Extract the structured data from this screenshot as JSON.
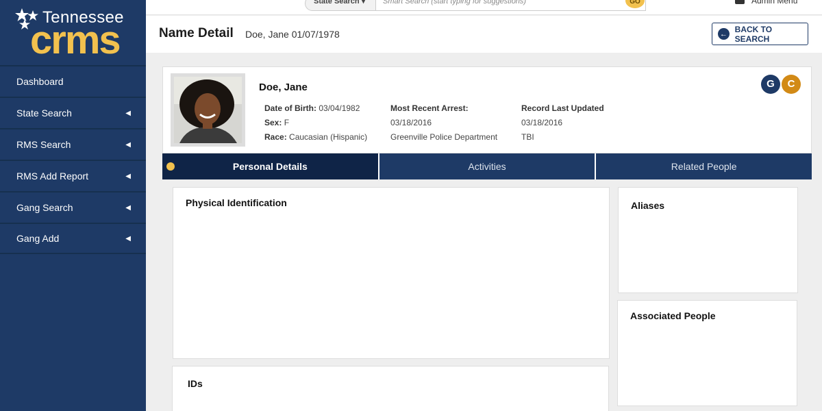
{
  "sidebar": {
    "logo_top": "Tennessee",
    "logo_main": "crms",
    "items": [
      {
        "label": "Dashboard",
        "has_arrow": false
      },
      {
        "label": "State Search",
        "has_arrow": true
      },
      {
        "label": "RMS Search",
        "has_arrow": true
      },
      {
        "label": "RMS Add Report",
        "has_arrow": true
      },
      {
        "label": "Gang Search",
        "has_arrow": true
      },
      {
        "label": "Gang Add",
        "has_arrow": true
      }
    ]
  },
  "topbar": {
    "scope_label": "State Search",
    "search_placeholder": "Smart Search (start typing for suggestions)",
    "go_label": "GO",
    "admin_label": "Admin Menu"
  },
  "header": {
    "title": "Name Detail",
    "subtitle": "Doe, Jane 01/07/1978",
    "back_label": "BACK TO SEARCH"
  },
  "profile": {
    "name": "Doe, Jane",
    "dob_label": "Date of Birth:",
    "dob": "03/04/1982",
    "sex_label": "Sex:",
    "sex": "F",
    "race_label": "Race:",
    "race": "Caucasian (Hispanic)",
    "arrest_label": "Most Recent Arrest:",
    "arrest_date": "03/18/2016",
    "arrest_agency": "Greenville Police Department",
    "updated_label": "Record Last Updated",
    "updated_date": "03/18/2016",
    "updated_agency": "TBI",
    "badges": [
      "G",
      "C"
    ],
    "badge_colors": {
      "G": "#1e3a66",
      "C": "#d28a16"
    }
  },
  "tabs": [
    {
      "label": "Personal Details",
      "active": true
    },
    {
      "label": "Activities",
      "active": false
    },
    {
      "label": "Related People",
      "active": false
    }
  ],
  "panels": {
    "physical": "Physical Identification",
    "ids": "IDs",
    "aliases": "Aliases",
    "associated": "Associated People"
  },
  "colors": {
    "primary": "#1e3a66",
    "accent": "#f2c14e"
  }
}
